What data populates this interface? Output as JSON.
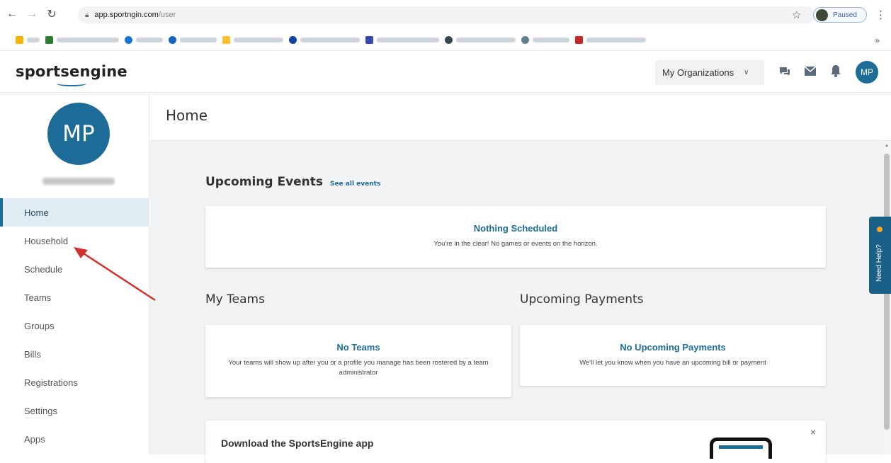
{
  "browser": {
    "url_host": "app.sportngin.com",
    "url_path": "/user",
    "profile_status": "Paused",
    "more_glyph": "»"
  },
  "header": {
    "logo_text": "sportsengine",
    "orgs_label": "My Organizations",
    "user_initials": "MP",
    "icons": [
      "chat-icon",
      "mail-icon",
      "bell-icon"
    ]
  },
  "sidebar": {
    "initials": "MP",
    "items": [
      {
        "label": "Home"
      },
      {
        "label": "Household"
      },
      {
        "label": "Schedule"
      },
      {
        "label": "Teams"
      },
      {
        "label": "Groups"
      },
      {
        "label": "Bills"
      },
      {
        "label": "Registrations"
      },
      {
        "label": "Settings"
      },
      {
        "label": "Apps"
      }
    ],
    "active_index": 0
  },
  "main": {
    "title": "Home",
    "upcoming_events": {
      "heading": "Upcoming Events",
      "link": "See all events",
      "card_title": "Nothing Scheduled",
      "card_text": "You're in the clear! No games or events on the horizon."
    },
    "my_teams": {
      "heading": "My Teams",
      "card_title": "No Teams",
      "card_text": "Your teams will show up after you or a profile you manage has been rostered by a team administrator"
    },
    "upcoming_payments": {
      "heading": "Upcoming Payments",
      "card_title": "No Upcoming Payments",
      "card_text": "We'll let you know when you have an upcoming bill or payment"
    },
    "download": {
      "title": "Download the SportsEngine app",
      "close": "×"
    }
  },
  "help_tab": {
    "label": "Need Help?"
  },
  "colors": {
    "brand_blue": "#1d6c98",
    "annotation_arrow": "#d32f2f"
  }
}
